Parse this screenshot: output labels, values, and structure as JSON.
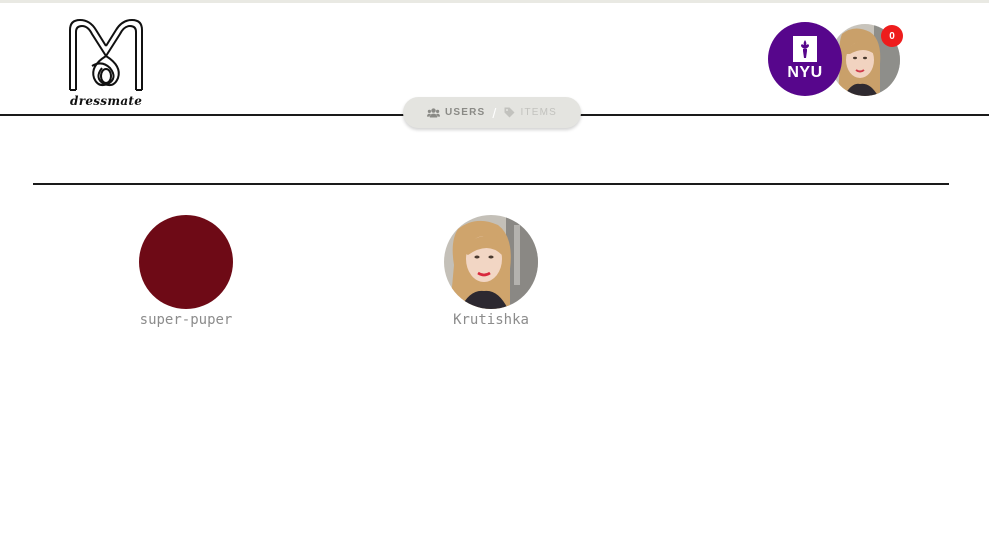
{
  "brand": {
    "logo_text": "dressmate",
    "logo_icon": "dressmate-monogram-logo"
  },
  "nav": {
    "users_label": "USERS",
    "items_label": "ITEMS",
    "separator": "/",
    "users_icon": "users-icon",
    "items_icon": "tag-icon",
    "active": "users"
  },
  "header_user": {
    "org_label": "NYU",
    "org_icon": "torch-icon",
    "notification_count": "0",
    "colors": {
      "org": "#57068c",
      "notification": "#ee1c1c"
    }
  },
  "users": [
    {
      "name": "super-puper",
      "avatar": "solid-color",
      "avatar_color": "#6e0a16"
    },
    {
      "name": "Krutishka",
      "avatar": "photo"
    }
  ]
}
